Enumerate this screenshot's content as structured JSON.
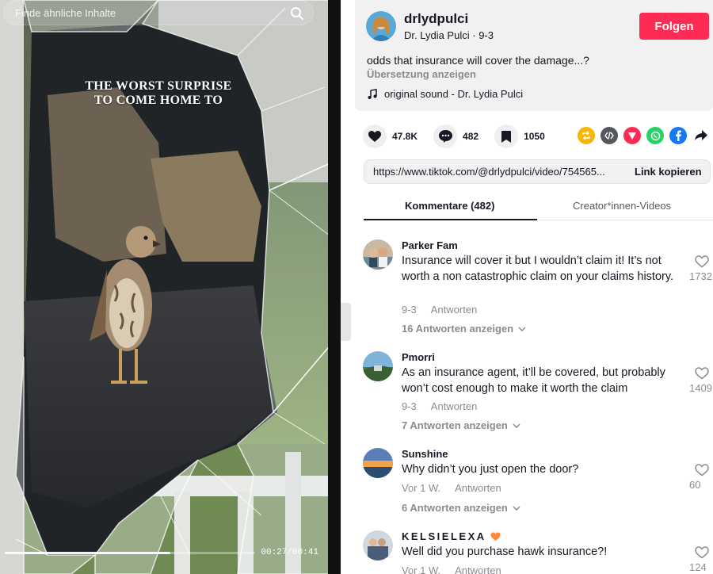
{
  "video": {
    "search_placeholder": "Finde ähnliche Inhalte",
    "overlay_line1": "THE WORST SURPRISE",
    "overlay_line2": "TO COME HOME TO",
    "time": "00:27/00:41",
    "progress": 0.66
  },
  "post": {
    "username": "drlydpulci",
    "display_name": "Dr. Lydia Pulci",
    "date": "9-3",
    "follow_label": "Folgen",
    "caption": "odds that insurance will cover the damage...?",
    "translate_label": "Übersetzung anzeigen",
    "music": "original sound - Dr. Lydia Pulci",
    "likes": "47.8K",
    "comments": "482",
    "saves": "1050",
    "link_url": "https://www.tiktok.com/@drlydpulci/video/754565...",
    "copy_label": "Link kopieren"
  },
  "share_icons": [
    {
      "icon": "repost-icon",
      "color": "#f5b700"
    },
    {
      "icon": "embed-icon",
      "color": "#54575e"
    },
    {
      "icon": "send-icon",
      "color": "#fe2c55"
    },
    {
      "icon": "whatsapp-icon",
      "color": "#25d366"
    },
    {
      "icon": "facebook-icon",
      "color": "#1877f2"
    },
    {
      "icon": "share-arrow-icon",
      "color": "#161823"
    }
  ],
  "tabs": {
    "comments": "Kommentare (482)",
    "creator": "Creator*innen-Videos"
  },
  "comments": [
    {
      "name": "Parker Fam",
      "text": "Insurance will cover it but I wouldn’t claim it! It’s not worth a non catastrophic claim on your claims history.",
      "date": "9-3",
      "reply": "Antworten",
      "replies": "16 Antworten anzeigen",
      "likes": "1732"
    },
    {
      "name": "Pmorri",
      "text": "As an insurance agent, it’ll be covered, but probably won’t cost enough to make it worth the claim",
      "date": "9-3",
      "reply": "Antworten",
      "replies": "7 Antworten anzeigen",
      "likes": "1409"
    },
    {
      "name": "Sunshine",
      "text": "Why didn’t you just open the door?",
      "date": "Vor 1 W.",
      "reply": "Antworten",
      "replies": "6 Antworten anzeigen",
      "likes": "60"
    },
    {
      "name": "KELSIELEXA",
      "text": "Well did you purchase hawk insurance?!",
      "date": "Vor 1 W.",
      "reply": "Antworten",
      "likes": "124"
    }
  ]
}
